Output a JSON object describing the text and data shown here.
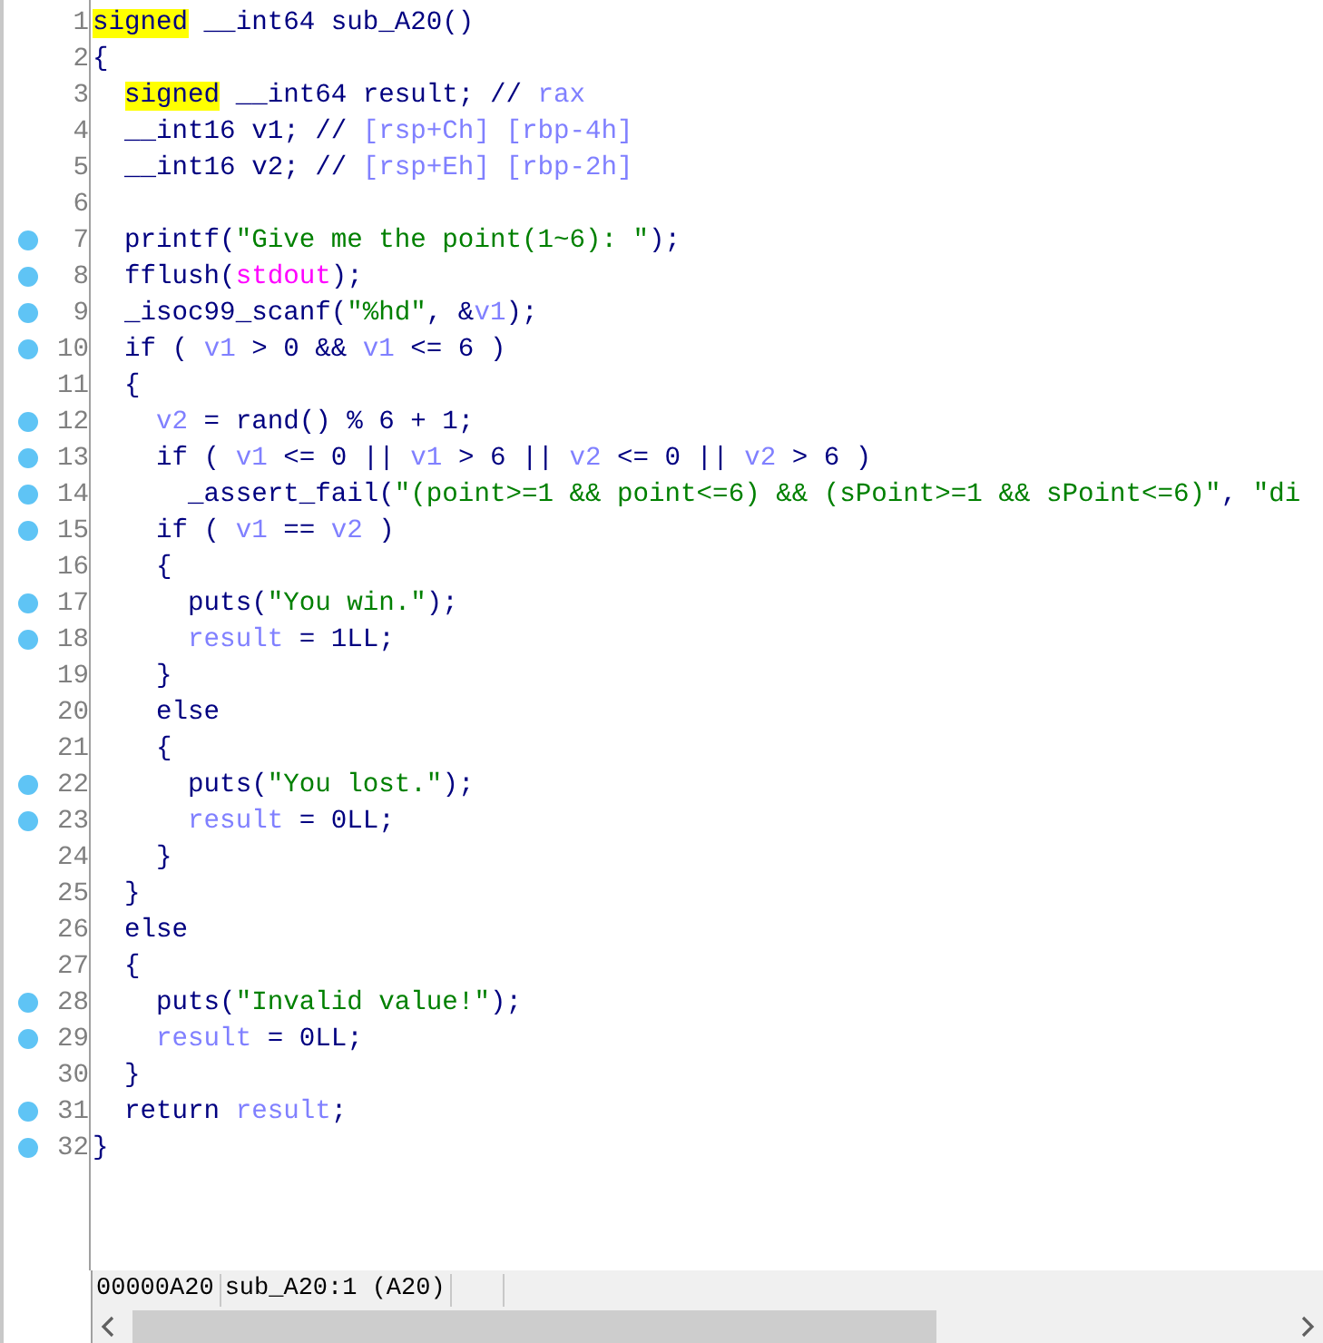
{
  "lines": [
    {
      "number": "1",
      "breakpoint": false,
      "tokens": [
        {
          "text": "signed",
          "kind": "hl"
        },
        {
          "text": " __int64 sub_A20()",
          "kind": "plain"
        }
      ]
    },
    {
      "number": "2",
      "breakpoint": false,
      "tokens": [
        {
          "text": "{",
          "kind": "plain"
        }
      ]
    },
    {
      "number": "3",
      "breakpoint": false,
      "tokens": [
        {
          "text": "  signed",
          "kind": "hl"
        },
        {
          "text": " __int64 result; // ",
          "kind": "plain"
        },
        {
          "text": "rax",
          "kind": "var"
        }
      ]
    },
    {
      "number": "4",
      "breakpoint": false,
      "tokens": [
        {
          "text": "  __int16 v1; // ",
          "kind": "plain"
        },
        {
          "text": "[rsp+Ch] [rbp-4h]",
          "kind": "var"
        }
      ]
    },
    {
      "number": "5",
      "breakpoint": false,
      "tokens": [
        {
          "text": "  __int16 v2; // ",
          "kind": "plain"
        },
        {
          "text": "[rsp+Eh] [rbp-2h]",
          "kind": "var"
        }
      ]
    },
    {
      "number": "6",
      "breakpoint": false
    },
    {
      "number": "7",
      "breakpoint": true,
      "tokens": [
        {
          "text": "  printf(",
          "kind": "plain"
        },
        {
          "text": "\"Give me the point(1~6): \"",
          "kind": "str"
        },
        {
          "text": ");",
          "kind": "plain"
        }
      ]
    },
    {
      "number": "8",
      "breakpoint": true,
      "tokens": [
        {
          "text": "  fflush(",
          "kind": "plain"
        },
        {
          "text": "stdout",
          "kind": "global"
        },
        {
          "text": ");",
          "kind": "plain"
        }
      ]
    },
    {
      "number": "9",
      "breakpoint": true,
      "tokens": [
        {
          "text": "  _isoc99_scanf(",
          "kind": "plain"
        },
        {
          "text": "\"%hd\"",
          "kind": "str"
        },
        {
          "text": ", &",
          "kind": "plain"
        },
        {
          "text": "v1",
          "kind": "var"
        },
        {
          "text": ");",
          "kind": "plain"
        }
      ]
    },
    {
      "number": "10",
      "breakpoint": true,
      "tokens": [
        {
          "text": "  if ( ",
          "kind": "plain"
        },
        {
          "text": "v1",
          "kind": "var"
        },
        {
          "text": " > 0 && ",
          "kind": "plain"
        },
        {
          "text": "v1",
          "kind": "var"
        },
        {
          "text": " <= 6 )",
          "kind": "plain"
        }
      ]
    },
    {
      "number": "11",
      "breakpoint": false,
      "tokens": [
        {
          "text": "  {",
          "kind": "plain"
        }
      ]
    },
    {
      "number": "12",
      "breakpoint": true,
      "tokens": [
        {
          "text": "    v2",
          "kind": "var"
        },
        {
          "text": " = rand() % 6 + 1;",
          "kind": "plain"
        }
      ]
    },
    {
      "number": "13",
      "breakpoint": true,
      "tokens": [
        {
          "text": "    if ( ",
          "kind": "plain"
        },
        {
          "text": "v1",
          "kind": "var"
        },
        {
          "text": " <= 0 || ",
          "kind": "plain"
        },
        {
          "text": "v1",
          "kind": "var"
        },
        {
          "text": " > 6 || ",
          "kind": "plain"
        },
        {
          "text": "v2",
          "kind": "var"
        },
        {
          "text": " <= 0 || ",
          "kind": "plain"
        },
        {
          "text": "v2",
          "kind": "var"
        },
        {
          "text": " > 6 )",
          "kind": "plain"
        }
      ]
    },
    {
      "number": "14",
      "breakpoint": true,
      "tokens": [
        {
          "text": "      _assert_fail(",
          "kind": "plain"
        },
        {
          "text": "\"(point>=1 && point<=6) && (sPoint>=1 && sPoint<=6)\"",
          "kind": "str"
        },
        {
          "text": ", ",
          "kind": "plain"
        },
        {
          "text": "\"di",
          "kind": "str"
        }
      ]
    },
    {
      "number": "15",
      "breakpoint": true,
      "tokens": [
        {
          "text": "    if ( ",
          "kind": "plain"
        },
        {
          "text": "v1",
          "kind": "var"
        },
        {
          "text": " == ",
          "kind": "plain"
        },
        {
          "text": "v2",
          "kind": "var"
        },
        {
          "text": " )",
          "kind": "plain"
        }
      ]
    },
    {
      "number": "16",
      "breakpoint": false,
      "tokens": [
        {
          "text": "    {",
          "kind": "plain"
        }
      ]
    },
    {
      "number": "17",
      "breakpoint": true,
      "tokens": [
        {
          "text": "      puts(",
          "kind": "plain"
        },
        {
          "text": "\"You win.\"",
          "kind": "str"
        },
        {
          "text": ");",
          "kind": "plain"
        }
      ]
    },
    {
      "number": "18",
      "breakpoint": true,
      "tokens": [
        {
          "text": "      result",
          "kind": "var"
        },
        {
          "text": " = 1LL;",
          "kind": "plain"
        }
      ]
    },
    {
      "number": "19",
      "breakpoint": false,
      "tokens": [
        {
          "text": "    }",
          "kind": "plain"
        }
      ]
    },
    {
      "number": "20",
      "breakpoint": false,
      "tokens": [
        {
          "text": "    else",
          "kind": "plain"
        }
      ]
    },
    {
      "number": "21",
      "breakpoint": false,
      "tokens": [
        {
          "text": "    {",
          "kind": "plain"
        }
      ]
    },
    {
      "number": "22",
      "breakpoint": true,
      "tokens": [
        {
          "text": "      puts(",
          "kind": "plain"
        },
        {
          "text": "\"You lost.\"",
          "kind": "str"
        },
        {
          "text": ");",
          "kind": "plain"
        }
      ]
    },
    {
      "number": "23",
      "breakpoint": true,
      "tokens": [
        {
          "text": "      result",
          "kind": "var"
        },
        {
          "text": " = 0LL;",
          "kind": "plain"
        }
      ]
    },
    {
      "number": "24",
      "breakpoint": false,
      "tokens": [
        {
          "text": "    }",
          "kind": "plain"
        }
      ]
    },
    {
      "number": "25",
      "breakpoint": false,
      "tokens": [
        {
          "text": "  }",
          "kind": "plain"
        }
      ]
    },
    {
      "number": "26",
      "breakpoint": false,
      "tokens": [
        {
          "text": "  else",
          "kind": "plain"
        }
      ]
    },
    {
      "number": "27",
      "breakpoint": false,
      "tokens": [
        {
          "text": "  {",
          "kind": "plain"
        }
      ]
    },
    {
      "number": "28",
      "breakpoint": true,
      "tokens": [
        {
          "text": "    puts(",
          "kind": "plain"
        },
        {
          "text": "\"Invalid value!\"",
          "kind": "str"
        },
        {
          "text": ");",
          "kind": "plain"
        }
      ]
    },
    {
      "number": "29",
      "breakpoint": true,
      "tokens": [
        {
          "text": "    result",
          "kind": "var"
        },
        {
          "text": " = 0LL;",
          "kind": "plain"
        }
      ]
    },
    {
      "number": "30",
      "breakpoint": false,
      "tokens": [
        {
          "text": "  }",
          "kind": "plain"
        }
      ]
    },
    {
      "number": "31",
      "breakpoint": true,
      "tokens": [
        {
          "text": "  return ",
          "kind": "plain"
        },
        {
          "text": "result",
          "kind": "var"
        },
        {
          "text": ";",
          "kind": "plain"
        }
      ]
    },
    {
      "number": "32",
      "breakpoint": true,
      "tokens": [
        {
          "text": "}",
          "kind": "plain"
        }
      ]
    }
  ],
  "status_bar": {
    "address": "00000A20",
    "location": "sub_A20:1 (A20)"
  }
}
